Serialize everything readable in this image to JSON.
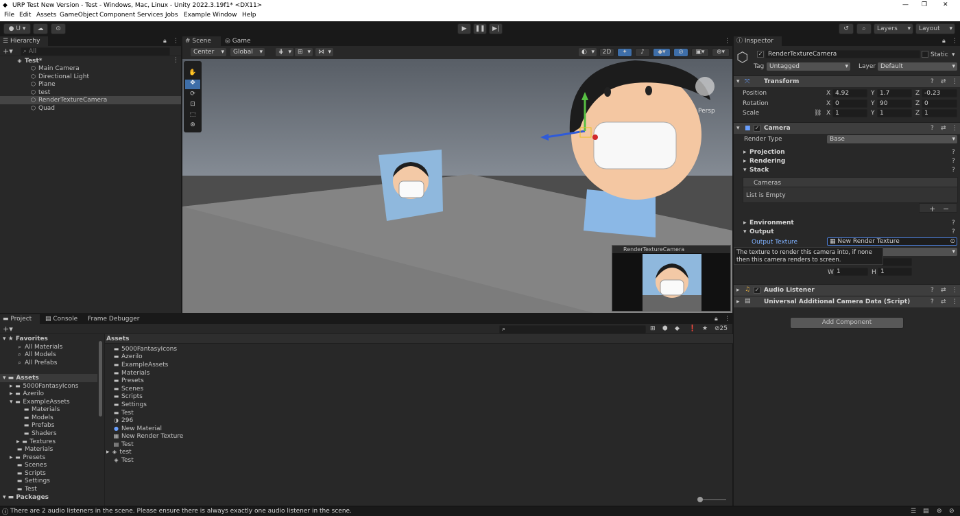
{
  "window": {
    "title": "URP Test New Version - Test - Windows, Mac, Linux - Unity 2022.3.19f1* <DX11>",
    "minimize": "—",
    "maximize": "❐",
    "close": "✕"
  },
  "menu": [
    "File",
    "Edit",
    "Assets",
    "GameObject",
    "Component",
    "Services",
    "Jobs",
    "Example",
    "Window",
    "Help"
  ],
  "toolbar": {
    "account": "U ▾",
    "layers": "Layers",
    "layout": "Layout"
  },
  "hierarchy": {
    "tab": "Hierarchy",
    "search_placeholder": "All",
    "scene": "Test*",
    "items": [
      "Main Camera",
      "Directional Light",
      "Plane",
      "test",
      "RenderTextureCamera",
      "Quad"
    ]
  },
  "scene": {
    "tabs": [
      "Scene",
      "Game"
    ],
    "pivot": "Center",
    "space": "Global",
    "mode2d": "2D",
    "persp": "Persp",
    "preview_title": "RenderTextureCamera"
  },
  "inspector": {
    "tab": "Inspector",
    "object_name": "RenderTextureCamera",
    "static": "Static",
    "tag_label": "Tag",
    "tag": "Untagged",
    "layer_label": "Layer",
    "layer": "Default",
    "transform": {
      "title": "Transform",
      "position_label": "Position",
      "rotation_label": "Rotation",
      "scale_label": "Scale",
      "position": [
        "4.92",
        "1.7",
        "-0.23"
      ],
      "rotation": [
        "0",
        "90",
        "0"
      ],
      "scale": [
        "1",
        "1",
        "1"
      ]
    },
    "camera": {
      "title": "Camera",
      "render_type_label": "Render Type",
      "render_type": "Base",
      "projection": "Projection",
      "rendering": "Rendering",
      "stack": "Stack",
      "cameras": "Cameras",
      "list_empty": "List is Empty",
      "environment": "Environment",
      "output": "Output",
      "output_texture_label": "Output Texture",
      "output_texture": "New Render Texture",
      "tooltip": "The texture to render this camera into, if none then this camera renders to screen.",
      "w": "1",
      "h": "1"
    },
    "audio_listener": "Audio Listener",
    "ucad": "Universal Additional Camera Data (Script)",
    "add_component": "Add Component"
  },
  "project": {
    "tabs": [
      "Project",
      "Console",
      "Frame Debugger"
    ],
    "favorites": "Favorites",
    "fav_items": [
      "All Materials",
      "All Models",
      "All Prefabs"
    ],
    "assets": "Assets",
    "tree": [
      "5000FantasyIcons",
      "Azerilo",
      "ExampleAssets",
      "Materials",
      "Models",
      "Prefabs",
      "Shaders",
      "Textures",
      "Materials",
      "Presets",
      "Scenes",
      "Scripts",
      "Settings",
      "Test"
    ],
    "packages": "Packages",
    "breadcrumb": "Assets",
    "files": [
      "5000FantasyIcons",
      "Azerilo",
      "ExampleAssets",
      "Materials",
      "Presets",
      "Scenes",
      "Scripts",
      "Settings",
      "Test",
      "296",
      "New Material",
      "New Render Texture",
      "Test",
      "test",
      "Test"
    ],
    "hidden_count": "25"
  },
  "status": "There are 2 audio listeners in the scene. Please ensure there is always exactly one audio listener in the scene."
}
